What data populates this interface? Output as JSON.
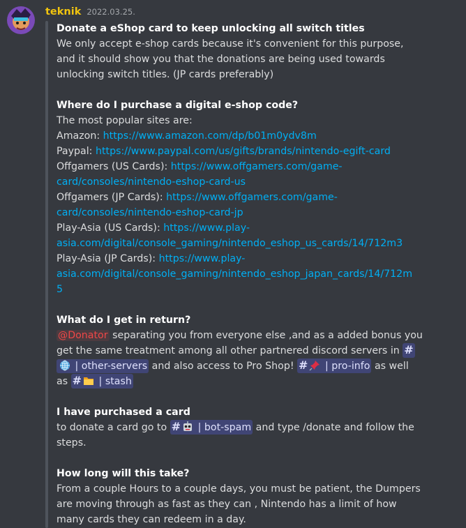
{
  "message": {
    "username": "teknik",
    "timestamp": "2022.03.25.",
    "username_color": "#f1c40f"
  },
  "sections": {
    "s1": {
      "heading": "Donate a eShop card to keep unlocking all switch titles",
      "lines": [
        "We only accept e-shop cards because it's convenient for this purpose,",
        "and it should show you that the donations are being used towards",
        "unlocking switch titles. (JP cards preferably)"
      ]
    },
    "s2": {
      "heading": "Where do I purchase a digital e-shop code?",
      "intro": "The most popular sites are:",
      "amazon_label": "Amazon: ",
      "amazon_url": "https://www.amazon.com/dp/b01m0ydv8m",
      "paypal_label": "Paypal: ",
      "paypal_url": "https://www.paypal.com/us/gifts/brands/nintendo-egift-card",
      "og_us_label": "Offgamers (US Cards): ",
      "og_us_url_1": "https://www.offgamers.com/game-",
      "og_us_url_2": "card/consoles/nintendo-eshop-card-us",
      "og_jp_label": "Offgamers (JP Cards): ",
      "og_jp_url_1": "https://www.offgamers.com/game-",
      "og_jp_url_2": "card/consoles/nintendo-eshop-card-jp",
      "pa_us_label": "Play-Asia (US Cards): ",
      "pa_us_url_1": "https://www.play-",
      "pa_us_url_2": "asia.com/digital/console_gaming/nintendo_eshop_us_cards/14/712m3",
      "pa_jp_label": "Play-Asia (JP Cards): ",
      "pa_jp_url_1": "https://www.play-",
      "pa_jp_url_2": "asia.com/digital/console_gaming/nintendo_eshop_japan_cards/14/712m",
      "pa_jp_url_3": "5"
    },
    "s3": {
      "heading": "What do I get in return?",
      "mention": "@Donator",
      "l1_after": " separating you from everyone else ,and as a added bonus you",
      "l2_before": "get the same treatment among all other partnered discord servers in ",
      "l3_chan": " | other-servers",
      "l3_after": " and also access to Pro Shop! ",
      "l3_chan2": " | pro-info",
      "l3_end": " as well",
      "l4_before": "as ",
      "l4_chan": " | stash"
    },
    "s4": {
      "heading": "I have purchased a card",
      "before": "to donate a card go to ",
      "chan": " | bot-spam",
      "after": " and type /donate and follow the",
      "line2": "steps."
    },
    "s5": {
      "heading": "How long will this take?",
      "lines": [
        "From a couple Hours to a couple days, you must be patient, the Dumpers",
        "are moving through as fast as they can , Nintendo has a limit of how",
        "many cards they can redeem in a day."
      ]
    }
  },
  "channel_hash": "#",
  "icons": {
    "globe": "globe-icon",
    "pin": "pushpin-icon",
    "folder": "folder-icon",
    "robot": "robot-icon"
  }
}
